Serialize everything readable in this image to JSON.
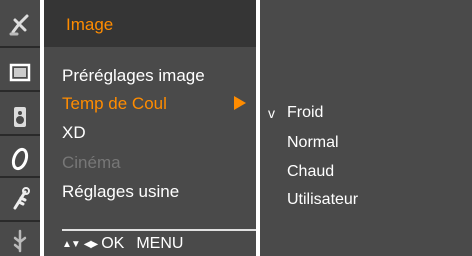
{
  "menu": {
    "title": "Image",
    "items": [
      {
        "label": "Préréglages image",
        "state": "normal"
      },
      {
        "label": "Temp de Coul",
        "state": "selected"
      },
      {
        "label": "XD",
        "state": "normal"
      },
      {
        "label": "Cinéma",
        "state": "disabled"
      },
      {
        "label": "Réglages usine",
        "state": "normal"
      }
    ]
  },
  "submenu": {
    "check_mark": "v",
    "options": [
      "Froid",
      "Normal",
      "Chaud",
      "Utilisateur"
    ],
    "selected_index": 0
  },
  "footer": {
    "up_down_glyph": "▲▼",
    "left_right_glyph": "◀▶",
    "ok_label": "OK",
    "menu_label": "MENU"
  },
  "sidebar_icons": [
    "satellite-dish-icon",
    "picture-screen-icon",
    "speaker-audio-icon",
    "clock-time-icon",
    "key-lock-icon",
    "input-plug-icon"
  ],
  "colors": {
    "panel_bg": "#4a4a4a",
    "header_bg": "#353535",
    "accent": "#ff8c00",
    "text": "#ffffff",
    "disabled_text": "#777777"
  }
}
